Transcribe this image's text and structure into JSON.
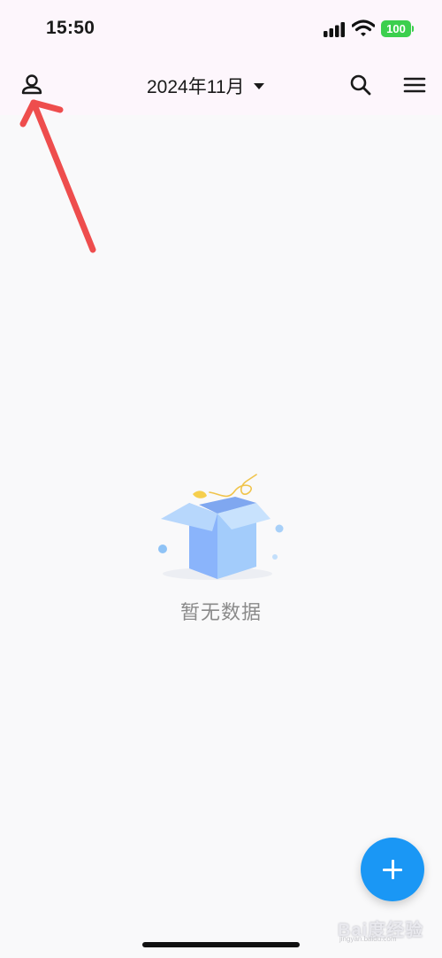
{
  "status_bar": {
    "time": "15:50",
    "battery": "100"
  },
  "header": {
    "month": "2024年11月"
  },
  "icons": {
    "profile": "person-icon",
    "month_dropdown": "caret-down-icon",
    "search": "search-icon",
    "menu": "hamburger-menu-icon",
    "add": "plus-icon",
    "empty_state": "empty-box-illustration"
  },
  "empty_state": {
    "message": "暂无数据"
  },
  "annotation": {
    "color": "#ee4d4d",
    "target": "profile button"
  },
  "watermark": {
    "text": "Bai度经验",
    "sub": "jingyan.baidu.com"
  },
  "colors": {
    "header_bg": "#fdf6fc",
    "page_bg": "#f9f9fa",
    "fab": "#1a97f5",
    "battery": "#3ccf4e",
    "empty_text": "#8a8a8a"
  }
}
